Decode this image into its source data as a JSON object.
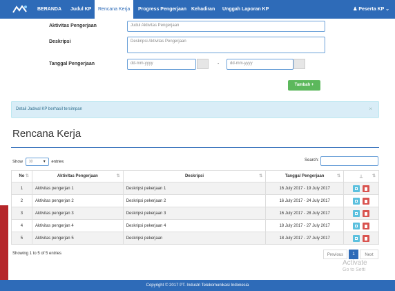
{
  "nav": {
    "items": [
      "BERANDA",
      "Judul KP",
      "Rencana Kerja",
      "Progress Pengerjaan",
      "Kehadiran",
      "Unggah Laporan KP"
    ],
    "user": "Peserta KP"
  },
  "form": {
    "aktivitas_label": "Aktivitas Pengerjaan",
    "aktivitas_placeholder": "Judul Aktivitas Pengerjaan",
    "deskripsi_label": "Deskripsi",
    "deskripsi_placeholder": "Deskripsi Aktivitas Pengerjaan",
    "tanggal_label": "Tanggal Pengerjaan",
    "date_start_placeholder": "dd-mm-yyyy",
    "date_end_placeholder": "dd-mm-yyyy",
    "separator": "-",
    "add_button": "Tambah"
  },
  "alert": {
    "message": "Detail Jadwal KP berhasil tersimpan",
    "close": "×"
  },
  "section_title": "Rencana Kerja",
  "table_controls": {
    "show_label": "Show",
    "entries_value": "10",
    "entries_label": "entries",
    "search_label": "Search:"
  },
  "table": {
    "headers": [
      "No",
      "Aktivitas Pengerjaan",
      "Deskripsi",
      "Tanggal Pengerjaan",
      "⊥"
    ],
    "rows": [
      {
        "no": "1",
        "aktivitas": "Aktivitas pengerjan 1",
        "deskripsi": "Deskripsi pekerjaan 1",
        "tanggal": "16 July 2017 - 19 July 2017"
      },
      {
        "no": "2",
        "aktivitas": "Aktivitas pengerjan 2",
        "deskripsi": "Deskripsi pekerjaan 2",
        "tanggal": "16 July 2017 - 24 July 2017"
      },
      {
        "no": "3",
        "aktivitas": "Aktivitas pengerjan 3",
        "deskripsi": "Deskripsi pekerjaan 3",
        "tanggal": "16 July 2017 - 28 July 2017"
      },
      {
        "no": "4",
        "aktivitas": "Aktivitas pengerjan 4",
        "deskripsi": "Deskripsi pekerjaan 4",
        "tanggal": "18 July 2017 - 27 July 2017"
      },
      {
        "no": "5",
        "aktivitas": "Aktivitas pengerjan 5",
        "deskripsi": "Deskripsi pekerjaan",
        "tanggal": "18 July 2017 - 27 July 2017"
      }
    ]
  },
  "pagination": {
    "info": "Showing 1 to 5 of 5 entries",
    "previous": "Previous",
    "current": "1",
    "next": "Next"
  },
  "watermark": {
    "line1": "Activate",
    "line2": "Go to Setti"
  },
  "footer": "Copyright © 2017 PT. Industri Telekomunikasi Indonesia",
  "colors": {
    "primary": "#2e6bb8",
    "success": "#5cb85c",
    "info": "#5bc0de",
    "danger": "#d9534f",
    "alert_bg": "#d9edf7"
  }
}
